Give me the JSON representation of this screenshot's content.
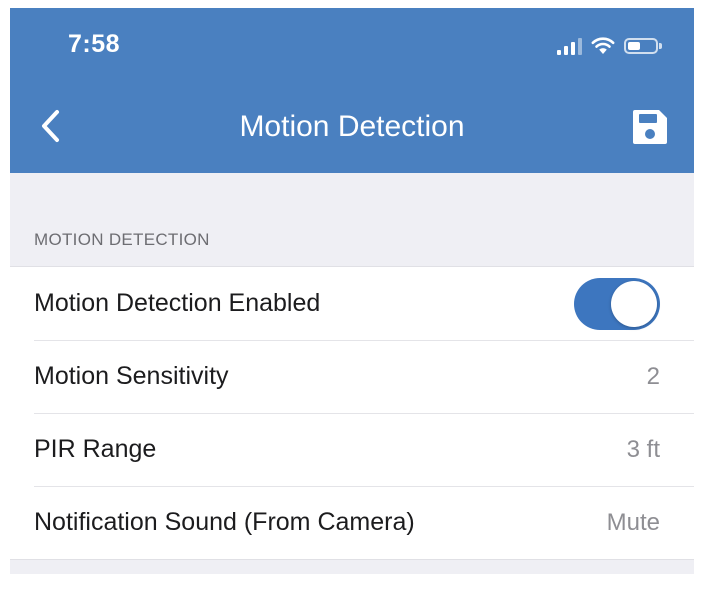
{
  "status_bar": {
    "time": "7:58"
  },
  "nav": {
    "title": "Motion Detection",
    "back_icon": "chevron-left-icon",
    "save_icon": "floppy-disk-icon"
  },
  "section": {
    "header": "MOTION DETECTION"
  },
  "settings": {
    "motion_enabled": {
      "label": "Motion Detection Enabled",
      "on": true
    },
    "sensitivity": {
      "label": "Motion Sensitivity",
      "value": "2"
    },
    "pir_range": {
      "label": "PIR Range",
      "value": "3 ft"
    },
    "notification_sound": {
      "label": "Notification Sound (From Camera)",
      "value": "Mute"
    }
  },
  "colors": {
    "header_background": "#4a80c0",
    "toggle_on": "#3d76bf",
    "page_background": "#efeff4"
  }
}
